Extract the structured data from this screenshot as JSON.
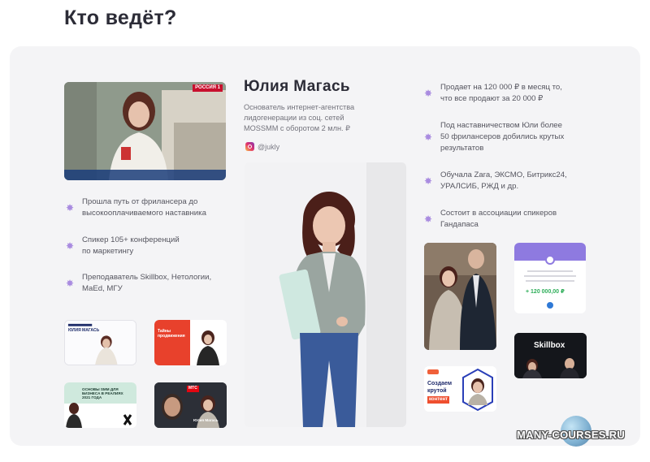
{
  "heading": "Кто ведёт?",
  "speaker": {
    "name": "Юлия Магась",
    "description": "Основатель интернет-агентства\nлидогенерации из соц. сетей\nMOSSMM с оборотом 2 млн. ₽",
    "instagram_handle": "@jukly"
  },
  "left_bullets": [
    "Прошла путь от фрилансера до\nвысокооплачиваемого наставника",
    "Спикер 105+ конференций\nпо маркетингу",
    "Преподаватель Skillbox, Нетологии,\nMaEd, МГУ"
  ],
  "right_bullets": [
    "Продает на 120 000 ₽ в месяц то,\nчто все продают за 20 000 ₽",
    "Под наставничеством Юли более\n50 фрилансеров добились крутых\nрезультатов",
    "Обучала Zara, ЭКСМО, Битрикс24,\nУРАЛСИБ, РЖД и др.",
    "Состоит в ассоциации спикеров\nГандапаса"
  ],
  "tiles": {
    "tv_channel": "РОССИЯ 1",
    "webinar1_title": "ЮЛИЯ МАГАСЬ",
    "webinar2_title": "Тайны продвижения",
    "smm_title": "ОСНОВЫ SMM ДЛЯ БИЗНЕСА В РЕАЛИЯХ 2021 ГОДА",
    "mts_title": "МТС",
    "mts_name": "Юлия Магась",
    "payment_amount": "+ 120 000,00 ₽",
    "skillbox_label": "Skillbox",
    "content_line1": "Создаем",
    "content_line2": "крутой",
    "content_line3": "контент"
  },
  "watermark": "MANY-COURSES.RU",
  "colors": {
    "accent_star": "#a98be0",
    "payment_header": "#8e7ae0",
    "payment_green": "#2fae5a"
  }
}
